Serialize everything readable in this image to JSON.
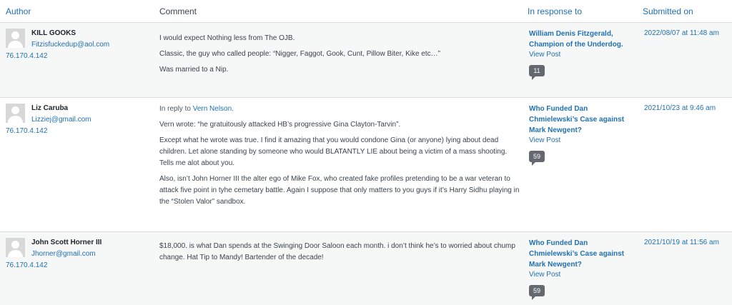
{
  "columns": {
    "author": "Author",
    "comment": "Comment",
    "in_response_to": "In response to",
    "submitted_on": "Submitted on"
  },
  "comments": [
    {
      "author_name": "KILL GOOKS",
      "author_email": "Fitzisfuckedup@aol.com",
      "author_ip": "76.170.4.142",
      "reply_prefix": "",
      "reply_to": "",
      "paragraphs": [
        "I would expect Nothing less from The OJB.",
        "Classic, the guy who called people: “Nigger, Faggot, Gook, Cunt, Pillow Biter, Kike etc…”",
        "Was married to a Nip."
      ],
      "post_title": "William Denis Fitzgerald, Champion of the Underdog.",
      "view_post": "View Post",
      "comment_count": "11",
      "submitted": "2022/08/07 at 11:48 am"
    },
    {
      "author_name": "Liz Caruba",
      "author_email": "Lizziej@gmail.com",
      "author_ip": "76.170.4.142",
      "reply_prefix": "In reply to",
      "reply_to": "Vern Nelson.",
      "paragraphs": [
        "Vern wrote: “he gratuitously attacked HB’s progressive Gina Clayton-Tarvin”.",
        "Except what he wrote was true. I find it amazing that you would condone Gina (or anyone) lying about dead children. Let alone standing by someone who would BLATANTLY LIE about being a victim of a mass shooting. Tells me alot about you.",
        "Also, isn’t John Horner III the alter ego of Mike Fox, who created fake profiles pretending to be a war veteran to attack five point in tyhe cemetary battle. Again I suppose that only matters to you guys if it’s Harry Sidhu playing in the “Stolen Valor” sandbox."
      ],
      "post_title": "Who Funded Dan Chmielewski’s Case against Mark Newgent?",
      "view_post": "View Post",
      "comment_count": "59",
      "submitted": "2021/10/23 at 9:46 am"
    },
    {
      "author_name": "John Scott Horner III",
      "author_email": "Jhorner@gmail.com",
      "author_ip": "76.170.4.142",
      "reply_prefix": "",
      "reply_to": "",
      "paragraphs": [
        "$18,000. is what Dan spends at the Swinging Door Saloon each month. i don’t think he’s to worried about chump change. Hat Tip to Mandy! Bartender of the decade!"
      ],
      "post_title": "Who Funded Dan Chmielewski’s Case against Mark Newgent?",
      "view_post": "View Post",
      "comment_count": "59",
      "submitted": "2021/10/19 at 11:56 am"
    }
  ]
}
